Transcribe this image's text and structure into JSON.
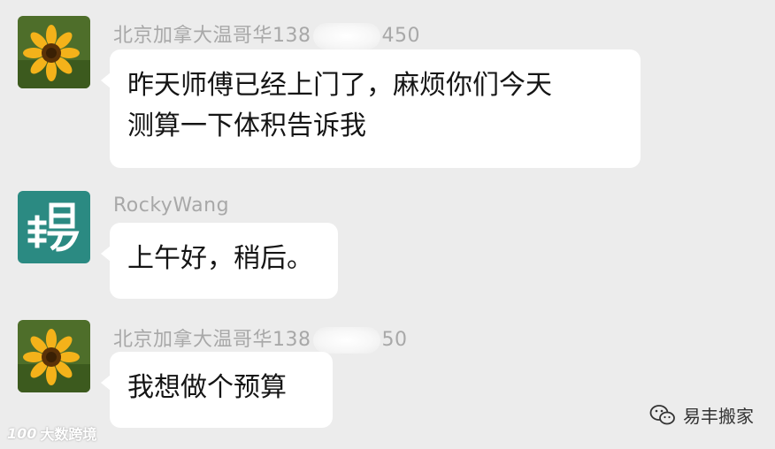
{
  "messages": [
    {
      "sender_prefix": "北京加拿大温哥华138",
      "sender_suffix": "450",
      "text_line1": "昨天师傅已经上门了，麻烦你们今天",
      "text_line2": "测算一下体积告诉我",
      "avatar": "sunflower-avatar"
    },
    {
      "sender": "RockyWang",
      "text": "上午好，稍后。",
      "avatar": "yifeng-logo-avatar"
    },
    {
      "sender_prefix": "北京加拿大温哥华138",
      "sender_suffix": "50",
      "text": "我想做个预算",
      "avatar": "sunflower-avatar"
    }
  ],
  "watermark_left": "大数跨境",
  "watermark_left_logo": "100",
  "watermark_right": "易丰搬家",
  "icons": {
    "wechat": "wechat-icon"
  },
  "colors": {
    "background": "#ececec",
    "bubble": "#ffffff",
    "sender_text": "#a8a8a8",
    "logo_teal": "#2b8a82"
  }
}
